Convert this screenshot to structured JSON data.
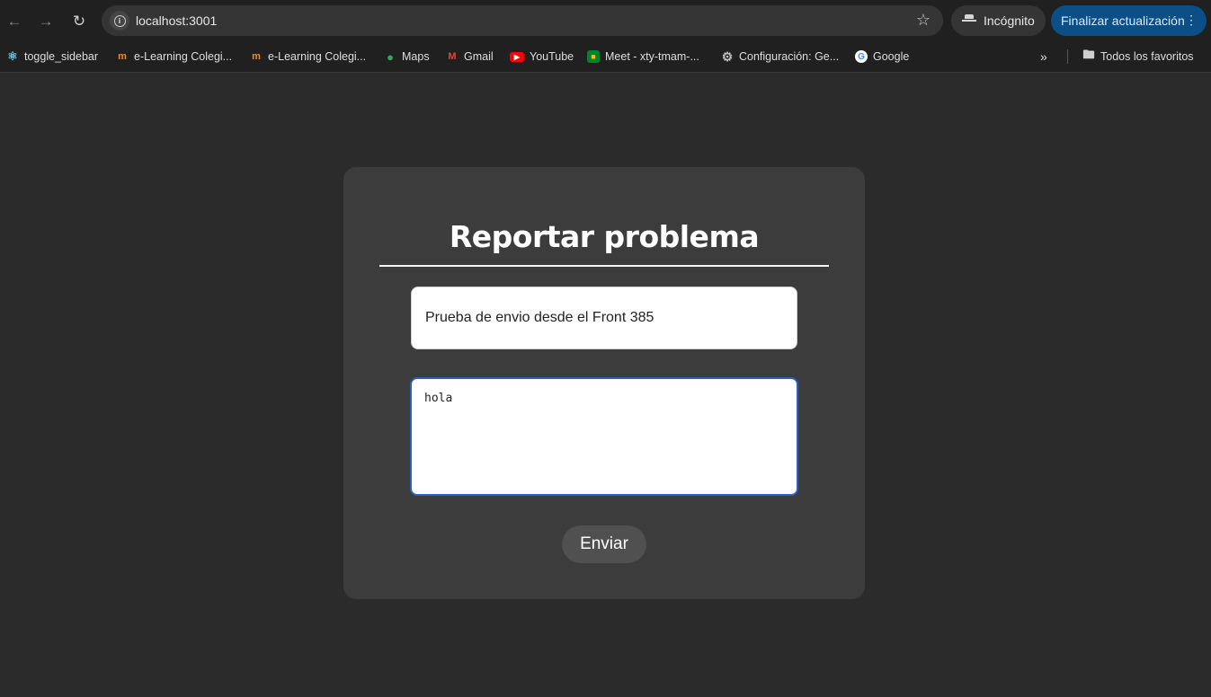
{
  "browser": {
    "url": "localhost:3001",
    "incognito_label": "Incógnito",
    "update_button_label": "Finalizar actualización"
  },
  "bookmarks": {
    "items": [
      {
        "label": "toggle_sidebar",
        "icon": "react-icon"
      },
      {
        "label": "e-Learning Colegi...",
        "icon": "moodle-icon"
      },
      {
        "label": "e-Learning Colegi...",
        "icon": "moodle-icon"
      },
      {
        "label": "Maps",
        "icon": "maps-pin-icon"
      },
      {
        "label": "Gmail",
        "icon": "gmail-icon"
      },
      {
        "label": "YouTube",
        "icon": "youtube-icon"
      },
      {
        "label": "Meet - xty-tmam-...",
        "icon": "meet-icon"
      },
      {
        "label": "Configuración: Ge...",
        "icon": "gear-icon"
      },
      {
        "label": "Google",
        "icon": "google-icon"
      }
    ],
    "all_bookmarks_label": "Todos los favoritos"
  },
  "form": {
    "title": "Reportar problema",
    "subject_value": "Prueba de envio desde el Front 385",
    "description_value": "hola",
    "submit_label": "Enviar"
  },
  "colors": {
    "page_background": "#2b2b2b",
    "card_background": "#3c3c3c",
    "focus_border": "#2a62c4",
    "update_button": "#0b4f86"
  }
}
